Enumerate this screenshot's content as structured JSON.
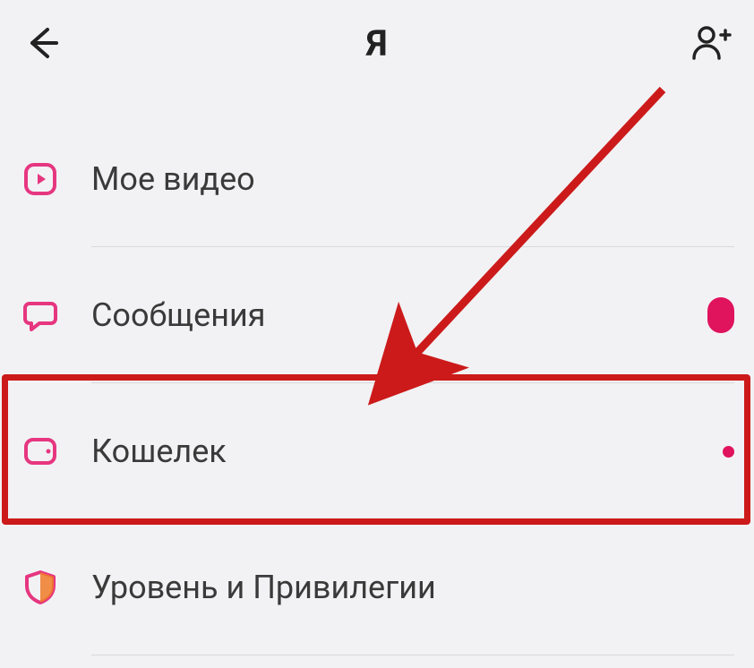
{
  "header": {
    "title": "Я"
  },
  "menu": {
    "items": [
      {
        "label": "Мое видео"
      },
      {
        "label": "Сообщения"
      },
      {
        "label": "Кошелек"
      },
      {
        "label": "Уровень и Привилегии"
      }
    ]
  }
}
